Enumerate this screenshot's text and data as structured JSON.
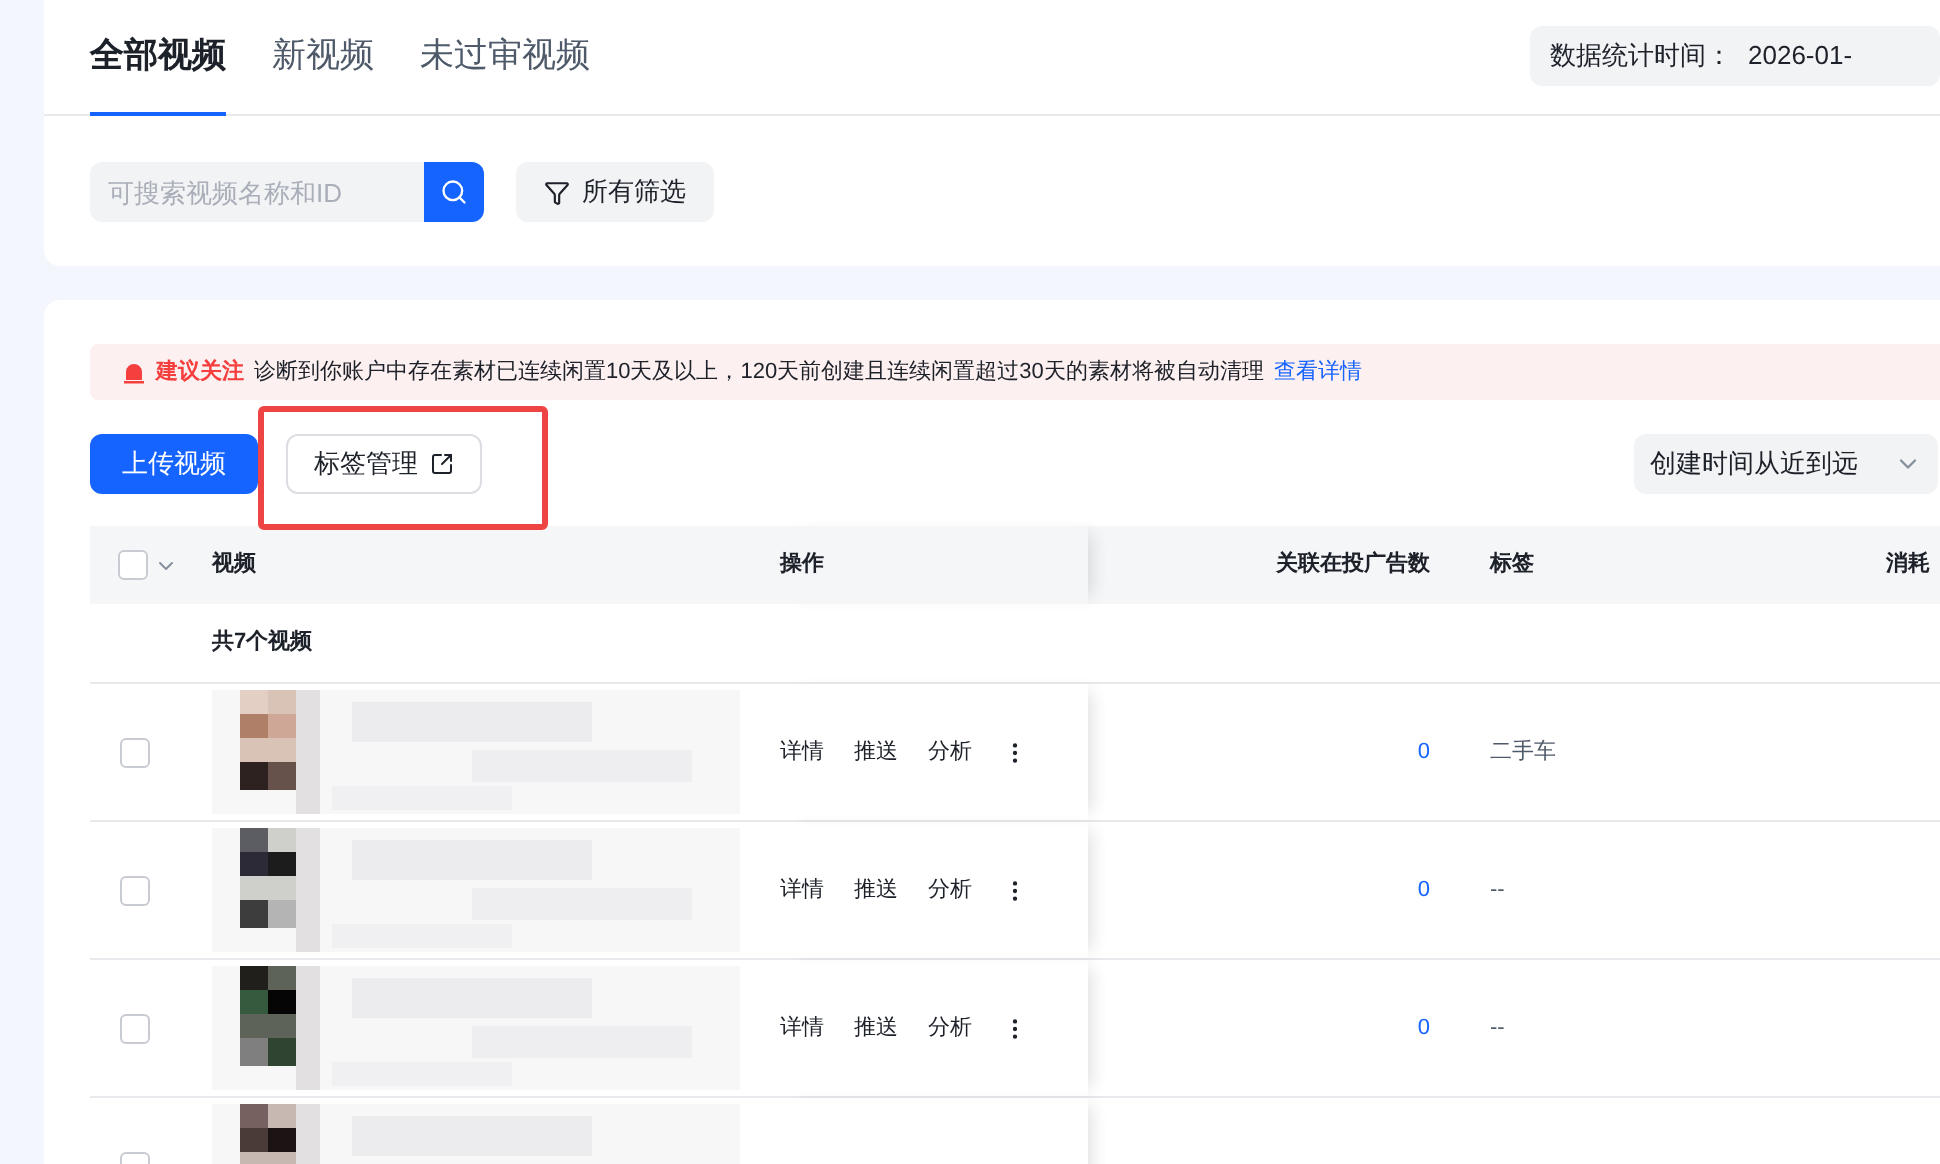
{
  "tabs": [
    {
      "label": "全部视频",
      "selected": true
    },
    {
      "label": "新视频",
      "selected": false
    },
    {
      "label": "未过审视频",
      "selected": false
    }
  ],
  "stats_time": {
    "label": "数据统计时间：",
    "value": "2026-01-"
  },
  "search": {
    "placeholder": "可搜索视频名称和ID"
  },
  "filter_button": "所有筛选",
  "alert": {
    "title": "建议关注",
    "message": "诊断到你账户中存在素材已连续闲置10天及以上，120天前创建且连续闲置超过30天的素材将被自动清理",
    "link": "查看详情"
  },
  "upload_button": "上传视频",
  "tag_button": "标签管理",
  "sort_select": "创建时间从近到远",
  "table": {
    "select_all": {
      "checked": false
    },
    "columns": [
      "视频",
      "操作",
      "关联在投广告数",
      "标签",
      "消耗"
    ],
    "summary": "共7个视频",
    "rows": [
      {
        "checked": false,
        "actions": [
          "详情",
          "推送",
          "分析"
        ],
        "ads": "0",
        "tag": "二手车"
      },
      {
        "checked": false,
        "actions": [
          "详情",
          "推送",
          "分析"
        ],
        "ads": "0",
        "tag": "--"
      },
      {
        "checked": false,
        "actions": [
          "详情",
          "推送",
          "分析"
        ],
        "ads": "0",
        "tag": "--"
      },
      {
        "checked": false
      }
    ]
  }
}
